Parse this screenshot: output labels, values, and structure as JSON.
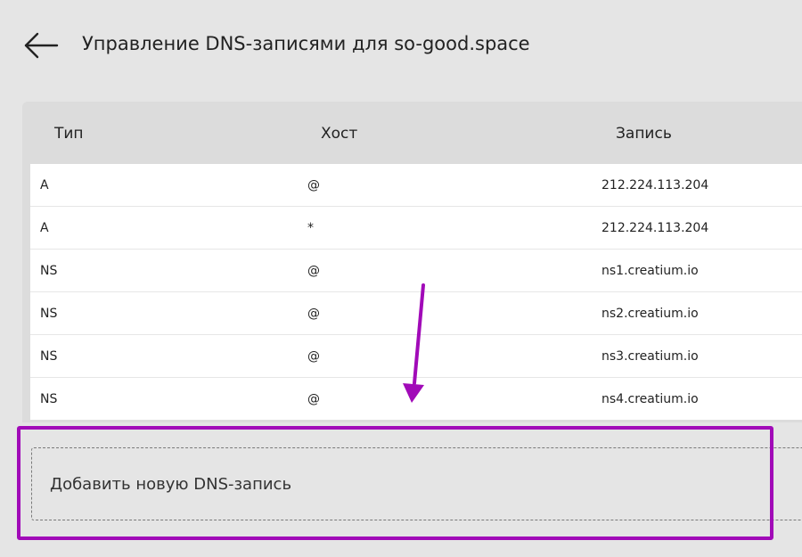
{
  "header": {
    "title": "Управление DNS-записями для so-good.space",
    "back_icon": "arrow-left-icon"
  },
  "table": {
    "columns": [
      "Тип",
      "Хост",
      "Запись"
    ],
    "rows": [
      {
        "type": "A",
        "host": "@",
        "value": "212.224.113.204"
      },
      {
        "type": "A",
        "host": "*",
        "value": "212.224.113.204"
      },
      {
        "type": "NS",
        "host": "@",
        "value": "ns1.creatium.io"
      },
      {
        "type": "NS",
        "host": "@",
        "value": "ns2.creatium.io"
      },
      {
        "type": "NS",
        "host": "@",
        "value": "ns3.creatium.io"
      },
      {
        "type": "NS",
        "host": "@",
        "value": "ns4.creatium.io"
      }
    ]
  },
  "add_record": {
    "label": "Добавить новую DNS-запись"
  },
  "colors": {
    "background": "#e5e5e5",
    "table_header": "#dcdcdc",
    "row_background": "#ffffff",
    "annotation": "#a10ab8"
  }
}
